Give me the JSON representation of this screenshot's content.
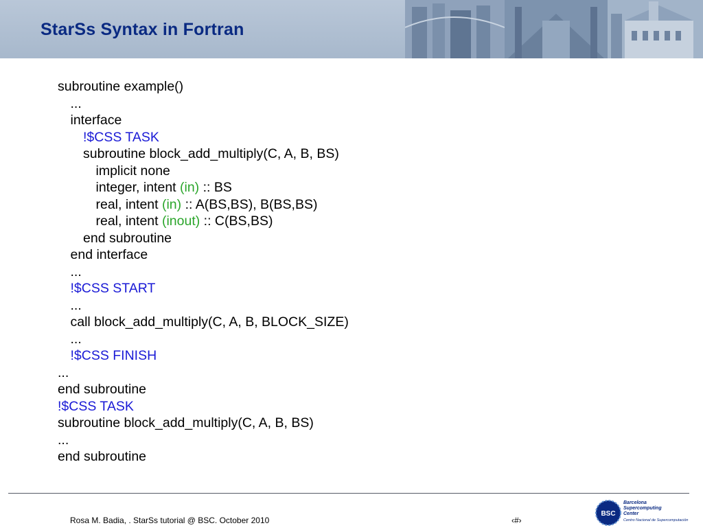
{
  "header": {
    "title": "StarSs Syntax in Fortran"
  },
  "code": {
    "lines": [
      {
        "indent": 0,
        "parts": [
          {
            "text": "subroutine example()",
            "style": "plain"
          }
        ]
      },
      {
        "indent": 1,
        "parts": [
          {
            "text": "...",
            "style": "plain"
          }
        ]
      },
      {
        "indent": 1,
        "parts": [
          {
            "text": "interface",
            "style": "plain"
          }
        ]
      },
      {
        "indent": 2,
        "parts": [
          {
            "text": "!$CSS TASK",
            "style": "blue"
          }
        ]
      },
      {
        "indent": 2,
        "parts": [
          {
            "text": "subroutine block_add_multiply(C, A, B, BS)",
            "style": "plain"
          }
        ]
      },
      {
        "indent": 3,
        "parts": [
          {
            "text": "implicit none",
            "style": "plain"
          }
        ]
      },
      {
        "indent": 3,
        "parts": [
          {
            "text": "integer, intent ",
            "style": "plain"
          },
          {
            "text": "(in)",
            "style": "green"
          },
          {
            "text": " :: BS",
            "style": "plain"
          }
        ]
      },
      {
        "indent": 3,
        "parts": [
          {
            "text": "real, intent ",
            "style": "plain"
          },
          {
            "text": "(in)",
            "style": "green"
          },
          {
            "text": " :: A(BS,BS), B(BS,BS)",
            "style": "plain"
          }
        ]
      },
      {
        "indent": 3,
        "parts": [
          {
            "text": "real, intent ",
            "style": "plain"
          },
          {
            "text": "(inout)",
            "style": "green"
          },
          {
            "text": " :: C(BS,BS)",
            "style": "plain"
          }
        ]
      },
      {
        "indent": 2,
        "parts": [
          {
            "text": "end subroutine",
            "style": "plain"
          }
        ]
      },
      {
        "indent": 1,
        "parts": [
          {
            "text": "end interface",
            "style": "plain"
          }
        ]
      },
      {
        "indent": 1,
        "parts": [
          {
            "text": "...",
            "style": "plain"
          }
        ]
      },
      {
        "indent": 1,
        "parts": [
          {
            "text": "!$CSS START",
            "style": "blue"
          }
        ]
      },
      {
        "indent": 1,
        "parts": [
          {
            "text": "...",
            "style": "plain"
          }
        ]
      },
      {
        "indent": 1,
        "parts": [
          {
            "text": "call block_add_multiply(C, A, B, BLOCK_SIZE)",
            "style": "plain"
          }
        ]
      },
      {
        "indent": 1,
        "parts": [
          {
            "text": "...",
            "style": "plain"
          }
        ]
      },
      {
        "indent": 1,
        "parts": [
          {
            "text": "!$CSS FINISH",
            "style": "blue"
          }
        ]
      },
      {
        "indent": 0,
        "parts": [
          {
            "text": "...",
            "style": "plain"
          }
        ]
      },
      {
        "indent": 0,
        "parts": [
          {
            "text": "end subroutine",
            "style": "plain"
          }
        ]
      },
      {
        "indent": 0,
        "parts": [
          {
            "text": "!$CSS TASK",
            "style": "blue"
          }
        ]
      },
      {
        "indent": 0,
        "parts": [
          {
            "text": "subroutine block_add_multiply(C, A, B, BS)",
            "style": "plain"
          }
        ]
      },
      {
        "indent": 0,
        "parts": [
          {
            "text": "...",
            "style": "plain"
          }
        ]
      },
      {
        "indent": 0,
        "parts": [
          {
            "text": "end subroutine",
            "style": "plain"
          }
        ]
      }
    ]
  },
  "footer": {
    "credit": "Rosa M. Badia, . StarSs tutorial @  BSC. October 2010",
    "page_number": "‹#›"
  },
  "logo": {
    "badge": "BSC",
    "name_lines": [
      "Barcelona",
      "Supercomputing",
      "Center"
    ],
    "subtitle": "Centro Nacional de Supercomputación"
  },
  "colors": {
    "title": "#0a2a82",
    "directive": "#1a1ad6",
    "intent": "#2aa52a",
    "header_band": "#a8b8cc"
  }
}
